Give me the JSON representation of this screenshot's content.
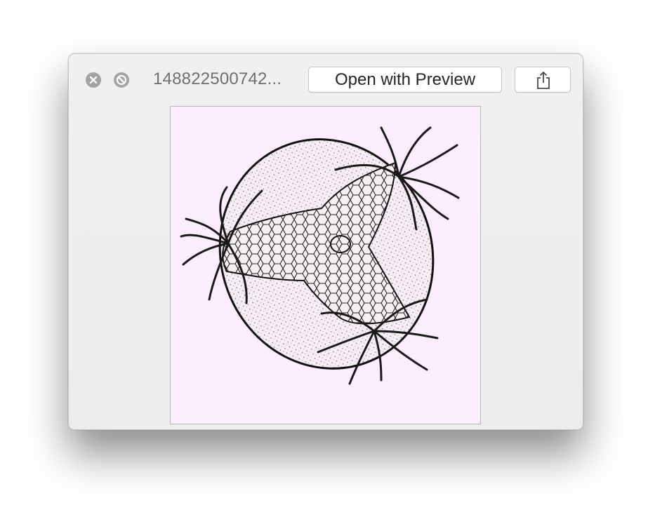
{
  "window": {
    "title": "148822500742...",
    "open_button_label": "Open with Preview",
    "controls": [
      "close-icon",
      "fullscreen-icon"
    ],
    "share_icon": "share-icon"
  },
  "preview": {
    "background_color": "#fceefe",
    "content": "illustration"
  }
}
